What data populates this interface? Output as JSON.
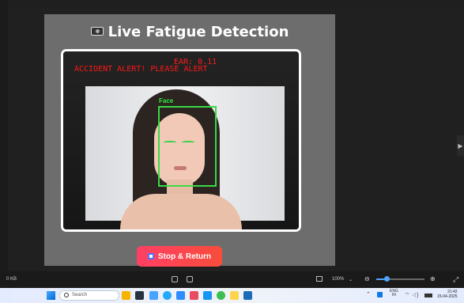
{
  "app": {
    "title": "Live Fatigue Detection",
    "camera_icon": "camera-icon",
    "overlay": {
      "ear": "EAR: 0.11",
      "alert": "ACCIDENT ALERT! PLEASE ALERT",
      "face_label": "Face"
    },
    "stop_button": "Stop & Return",
    "colors": {
      "alert": "#ff1616",
      "detection_box": "#39d945",
      "button_start": "#ff3f64",
      "button_end": "#f84c3b"
    }
  },
  "viewer": {
    "size_text": "0 KB",
    "zoom": "100%",
    "zoom_slider_level": 0.21,
    "icons": [
      "fit-icon",
      "fullscreen-icon",
      "fit-width-icon",
      "zoom-out-icon",
      "zoom-in-icon",
      "expand-icon"
    ]
  },
  "taskbar": {
    "search_placeholder": "Search",
    "apps": [
      "file-explorer-icon",
      "taskbar-app-icon",
      "edge-icon",
      "chrome-icon",
      "store-icon",
      "mail-icon",
      "code-icon",
      "whatsapp-icon",
      "folder-icon",
      "editor-icon"
    ],
    "language": "ENG",
    "region": "IN",
    "time": "21:42",
    "date": "15-04-2025"
  }
}
